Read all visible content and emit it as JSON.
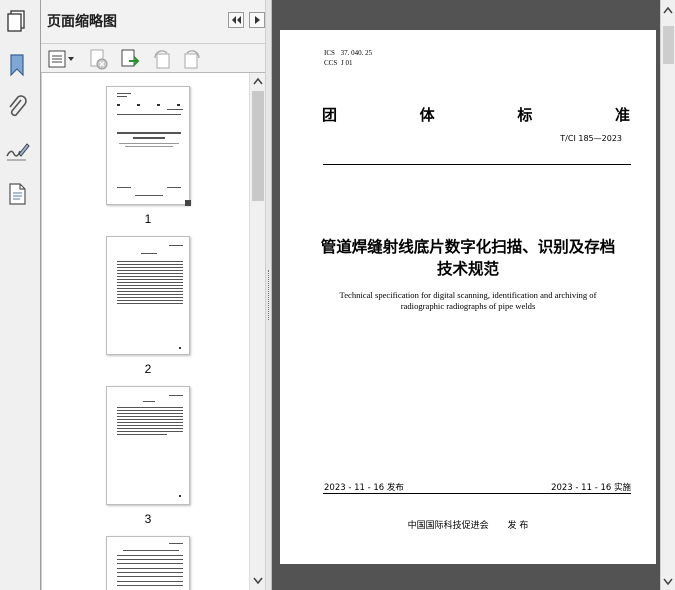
{
  "panel": {
    "title": "页面缩略图",
    "thumbnails": [
      {
        "page": "1"
      },
      {
        "page": "2"
      },
      {
        "page": "3"
      }
    ]
  },
  "document": {
    "ics_label": "ICS",
    "ics_value": "37. 040. 25",
    "ccs_label": "CCS",
    "ccs_value": "J  01",
    "std_type_chars": [
      "团",
      "体",
      "标",
      "准"
    ],
    "std_number": "T/CI  185—2023",
    "title_cn_line1": "管道焊缝射线底片数字化扫描、识别及存档",
    "title_cn_line2": "技术规范",
    "title_en_line1": "Technical specification for digital scanning, identification and archiving of",
    "title_en_line2": "radiographic radiographs of pipe welds",
    "publish_date": "2023 - 11 - 16 发布",
    "implement_date": "2023 - 11 - 16 实施",
    "publisher": "中国国际科技促进会",
    "publisher_action": "发  布"
  },
  "icons": {
    "strip": [
      "pages-icon",
      "bookmark-icon",
      "attachment-icon",
      "signature-icon",
      "layers-icon"
    ],
    "header": [
      "collapse-left-icon",
      "expand-right-icon"
    ],
    "toolbar": [
      "options-menu-icon",
      "delete-page-icon",
      "insert-page-icon",
      "rotate-ccw-icon",
      "rotate-cw-icon"
    ]
  },
  "colors": {
    "strip_bg": "#f0f0f0",
    "doc_bg": "#535353",
    "bookmark_blue": "#5b86b8"
  }
}
